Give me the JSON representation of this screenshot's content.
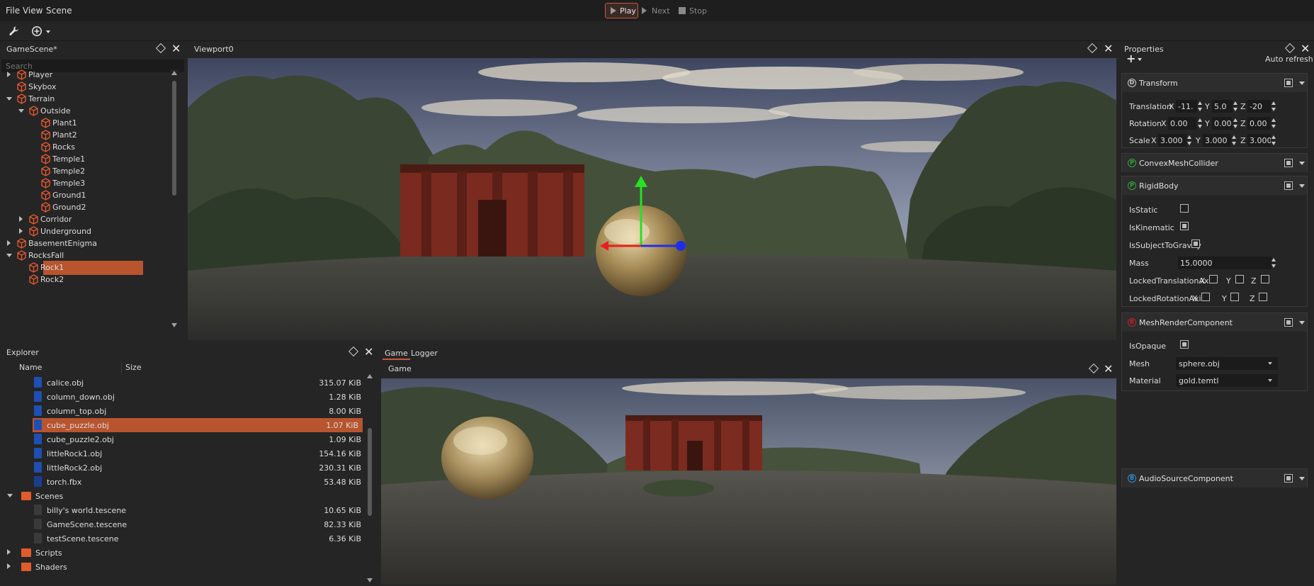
{
  "menu": {
    "file": "File",
    "view": "View",
    "scene": "Scene"
  },
  "playbar": {
    "play": "Play",
    "next": "Next",
    "stop": "Stop"
  },
  "colors": {
    "accent": "#c75a3c",
    "selection": "#b8542e",
    "panel_bg": "#252526",
    "folder": "#e15b2d",
    "obj_icon": "#1f4fb3"
  },
  "scene_panel": {
    "title": "GameScene*",
    "search_placeholder": "Search",
    "items": [
      {
        "label": "Player",
        "expander": "collapsed"
      },
      {
        "label": "Skybox",
        "expander": "none"
      },
      {
        "label": "Terrain",
        "expander": "expanded"
      },
      {
        "label": "Outside",
        "expander": "expanded"
      },
      {
        "label": "Plant1",
        "expander": "none"
      },
      {
        "label": "Plant2",
        "expander": "none"
      },
      {
        "label": "Rocks",
        "expander": "none"
      },
      {
        "label": "Temple1",
        "expander": "none"
      },
      {
        "label": "Temple2",
        "expander": "none"
      },
      {
        "label": "Temple3",
        "expander": "none"
      },
      {
        "label": "Ground1",
        "expander": "none"
      },
      {
        "label": "Ground2",
        "expander": "none"
      },
      {
        "label": "Corridor",
        "expander": "collapsed"
      },
      {
        "label": "Underground",
        "expander": "collapsed"
      },
      {
        "label": "BasementEnigma",
        "expander": "collapsed"
      },
      {
        "label": "RocksFall",
        "expander": "expanded"
      },
      {
        "label": "Rock1",
        "expander": "none",
        "selected": true
      },
      {
        "label": "Rock2",
        "expander": "none"
      }
    ]
  },
  "viewport": {
    "title": "Viewport0"
  },
  "explorer": {
    "title": "Explorer",
    "columns": [
      "Name",
      "Size"
    ],
    "rows": [
      {
        "name": "calice.obj",
        "size": "315.07 KiB",
        "kind": "obj"
      },
      {
        "name": "column_down.obj",
        "size": "1.28 KiB",
        "kind": "obj"
      },
      {
        "name": "column_top.obj",
        "size": "8.00 KiB",
        "kind": "obj"
      },
      {
        "name": "cube_puzzle.obj",
        "size": "1.07 KiB",
        "kind": "obj",
        "selected": true
      },
      {
        "name": "cube_puzzle2.obj",
        "size": "1.09 KiB",
        "kind": "obj"
      },
      {
        "name": "littleRock1.obj",
        "size": "154.16 KiB",
        "kind": "obj"
      },
      {
        "name": "littleRock2.obj",
        "size": "230.31 KiB",
        "kind": "obj"
      },
      {
        "name": "torch.fbx",
        "size": "53.48 KiB",
        "kind": "fbx"
      },
      {
        "name": "Scenes",
        "size": "",
        "kind": "folder",
        "expander": "expanded"
      },
      {
        "name": "billy's world.tescene",
        "size": "10.65 KiB",
        "kind": "scene"
      },
      {
        "name": "GameScene.tescene",
        "size": "82.33 KiB",
        "kind": "scene"
      },
      {
        "name": "testScene.tescene",
        "size": "6.36 KiB",
        "kind": "scene"
      },
      {
        "name": "Scripts",
        "size": "",
        "kind": "folder",
        "expander": "collapsed"
      },
      {
        "name": "Shaders",
        "size": "",
        "kind": "folder",
        "expander": "collapsed"
      }
    ]
  },
  "game": {
    "tabs": [
      "Game",
      "Logger"
    ],
    "title": "Game"
  },
  "properties": {
    "title": "Properties",
    "auto_refresh": "Auto refresh",
    "add_symbol": "+",
    "transform": {
      "title": "Transform",
      "icon_letter": "D",
      "translation": {
        "label": "Translation",
        "x": "-11.",
        "y": "5.0",
        "z": "-20"
      },
      "rotation": {
        "label": "Rotation",
        "x": "0.00",
        "y": "0.00",
        "z": "0.00"
      },
      "scale": {
        "label": "Scale",
        "x": "3.000",
        "y": "3.000",
        "z": "3.000"
      }
    },
    "convex": {
      "title": "ConvexMeshCollider",
      "icon_letter": "P"
    },
    "rigid": {
      "title": "RigidBody",
      "icon_letter": "P",
      "is_static": "IsStatic",
      "is_kinematic": "IsKinematic",
      "is_gravity": "IsSubjectToGravity",
      "mass_label": "Mass",
      "mass": "15.0000",
      "locked_t": "LockedTranslationAxis",
      "locked_r": "LockedRotationAxis"
    },
    "mesh": {
      "title": "MeshRenderComponent",
      "icon_letter": "R",
      "is_opaque": "IsOpaque",
      "mesh_label": "Mesh",
      "mesh_value": "sphere.obj",
      "material_label": "Material",
      "material_value": "gold.temtl"
    },
    "audio": {
      "title": "AudioSourceComponent",
      "icon_letter": "B"
    },
    "axis": {
      "x": "X",
      "y": "Y",
      "z": "Z"
    }
  }
}
